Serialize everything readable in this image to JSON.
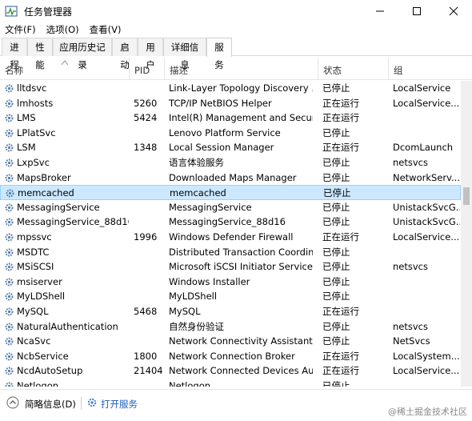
{
  "window": {
    "title": "任务管理器"
  },
  "menu": [
    "文件(F)",
    "选项(O)",
    "查看(V)"
  ],
  "tabs": [
    "进程",
    "性能",
    "应用历史记录",
    "启动",
    "用户",
    "详细信息",
    "服务"
  ],
  "active_tab": "服务",
  "columns": {
    "name": "名称",
    "pid": "PID",
    "desc": "描述",
    "status": "状态",
    "group": "组"
  },
  "rows": [
    {
      "name": "lltdsvc",
      "pid": "",
      "desc": "Link-Layer Topology Discovery ...",
      "status": "已停止",
      "group": "LocalService"
    },
    {
      "name": "lmhosts",
      "pid": "5260",
      "desc": "TCP/IP NetBIOS Helper",
      "status": "正在运行",
      "group": "LocalService..."
    },
    {
      "name": "LMS",
      "pid": "5424",
      "desc": "Intel(R) Management and Securit...",
      "status": "正在运行",
      "group": ""
    },
    {
      "name": "LPlatSvc",
      "pid": "",
      "desc": "Lenovo Platform Service",
      "status": "已停止",
      "group": ""
    },
    {
      "name": "LSM",
      "pid": "1348",
      "desc": "Local Session Manager",
      "status": "正在运行",
      "group": "DcomLaunch"
    },
    {
      "name": "LxpSvc",
      "pid": "",
      "desc": "语言体验服务",
      "status": "已停止",
      "group": "netsvcs"
    },
    {
      "name": "MapsBroker",
      "pid": "",
      "desc": "Downloaded Maps Manager",
      "status": "已停止",
      "group": "NetworkServ..."
    },
    {
      "name": "memcached",
      "pid": "",
      "desc": "memcached",
      "status": "已停止",
      "group": "",
      "selected": true
    },
    {
      "name": "MessagingService",
      "pid": "",
      "desc": "MessagingService",
      "status": "已停止",
      "group": "UnistackSvcG..."
    },
    {
      "name": "MessagingService_88d16",
      "pid": "",
      "desc": "MessagingService_88d16",
      "status": "已停止",
      "group": "UnistackSvcG..."
    },
    {
      "name": "mpssvc",
      "pid": "1996",
      "desc": "Windows Defender Firewall",
      "status": "正在运行",
      "group": "LocalService..."
    },
    {
      "name": "MSDTC",
      "pid": "",
      "desc": "Distributed Transaction Coordina...",
      "status": "已停止",
      "group": ""
    },
    {
      "name": "MSiSCSI",
      "pid": "",
      "desc": "Microsoft iSCSI Initiator Service",
      "status": "已停止",
      "group": "netsvcs"
    },
    {
      "name": "msiserver",
      "pid": "",
      "desc": "Windows Installer",
      "status": "已停止",
      "group": ""
    },
    {
      "name": "MyLDShell",
      "pid": "",
      "desc": "MyLDShell",
      "status": "已停止",
      "group": ""
    },
    {
      "name": "MySQL",
      "pid": "5468",
      "desc": "MySQL",
      "status": "正在运行",
      "group": ""
    },
    {
      "name": "NaturalAuthentication",
      "pid": "",
      "desc": "自然身份验证",
      "status": "已停止",
      "group": "netsvcs"
    },
    {
      "name": "NcaSvc",
      "pid": "",
      "desc": "Network Connectivity Assistant",
      "status": "已停止",
      "group": "NetSvcs"
    },
    {
      "name": "NcbService",
      "pid": "1800",
      "desc": "Network Connection Broker",
      "status": "正在运行",
      "group": "LocalSystem..."
    },
    {
      "name": "NcdAutoSetup",
      "pid": "21404",
      "desc": "Network Connected Devices Aut...",
      "status": "正在运行",
      "group": "LocalService..."
    },
    {
      "name": "Netlogon",
      "pid": "",
      "desc": "Netlogon",
      "status": "已停止",
      "group": ""
    }
  ],
  "footer": {
    "less_details": "简略信息(D)",
    "open_services": "打开服务"
  },
  "watermark": "@稀土掘金技术社区",
  "icons": {
    "app": "task-manager-icon",
    "service": "gear-icon",
    "collapse": "chevron-up-icon",
    "open_services": "gear-icon"
  },
  "colors": {
    "selected_bg": "#cce8ff",
    "selected_border": "#99d1ff",
    "link": "#1f5fbf"
  }
}
